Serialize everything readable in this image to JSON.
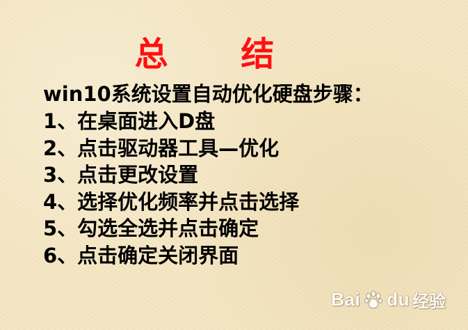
{
  "title": "总  结",
  "subtitle": "win10系统设置自动优化硬盘步骤：",
  "steps": [
    "1、在桌面进入D盘",
    "2、点击驱动器工具—优化",
    "3、点击更改设置",
    "4、选择优化频率并点击选择",
    "5、勾选全选并点击确定",
    "6、点击确定关闭界面"
  ],
  "watermark": {
    "baidu": "Bai",
    "baidu_suffix": "du",
    "jingyan": "经验",
    "icon": "paw-icon"
  },
  "colors": {
    "title": "#ff1010",
    "text": "#000000",
    "background": "#f4e6c2"
  }
}
